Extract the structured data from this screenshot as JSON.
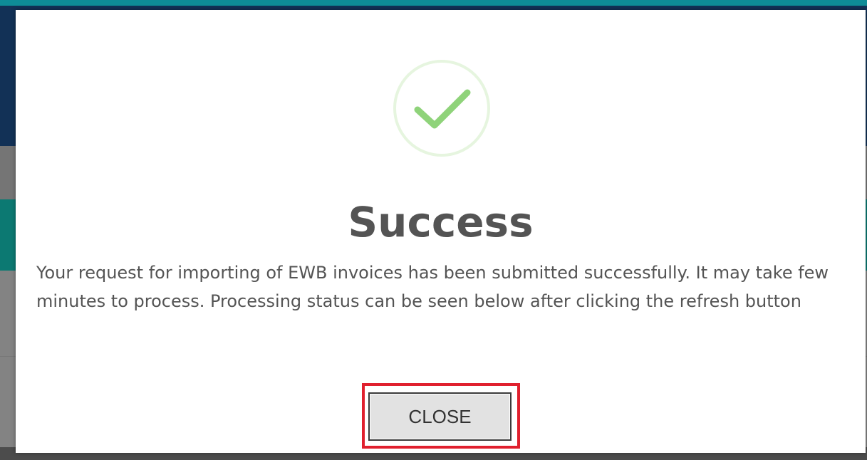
{
  "dialog": {
    "title": "Success",
    "message": "Your request for importing of EWB invoices has been submitted successfully. It may take few minutes to process. Processing status can be seen below after clicking the refresh button",
    "close_label": "CLOSE",
    "icon": "checkmark-icon"
  },
  "colors": {
    "check": "#8fd37a",
    "check_ring": "#e6f5df",
    "title_text": "#545454",
    "highlight": "#e0202e",
    "button_bg": "#e2e2e2"
  }
}
